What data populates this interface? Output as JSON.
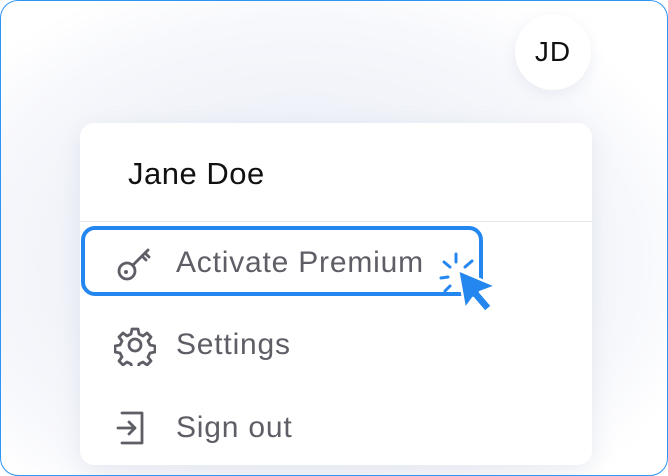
{
  "avatar": {
    "initials": "JD"
  },
  "menu": {
    "user_name": "Jane Doe",
    "items": [
      {
        "label": "Activate Premium",
        "icon": "key-icon",
        "highlighted": true
      },
      {
        "label": "Settings",
        "icon": "gear-icon",
        "highlighted": false
      },
      {
        "label": "Sign out",
        "icon": "sign-out-icon",
        "highlighted": false
      }
    ]
  },
  "colors": {
    "accent": "#2387ef",
    "frame_border": "#2f95f3",
    "item_text": "#5e5e66",
    "name_text": "#111111",
    "background": "#eef1f8"
  }
}
